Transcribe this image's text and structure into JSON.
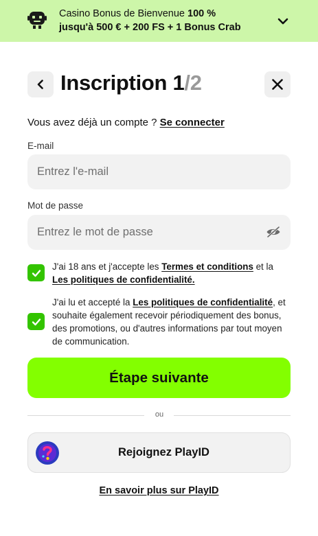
{
  "banner": {
    "icon": "robot-icon",
    "line1_normal": "Casino Bonus de Bienvenue ",
    "line1_bold": "100 %",
    "line2_bold": "jusqu'à 500 € + 200 FS + 1 Bonus Crab",
    "chevron": "chevron-down-icon",
    "bg_color": "#cdf6a9"
  },
  "header": {
    "back_icon": "chevron-left-icon",
    "title": "Inscription 1",
    "step_total": "/2",
    "close_icon": "close-icon"
  },
  "login_prompt": {
    "text": "Vous avez déjà un compte ? ",
    "link": "Se connecter"
  },
  "email": {
    "label": "E-mail",
    "placeholder": "Entrez l'e-mail",
    "value": ""
  },
  "password": {
    "label": "Mot de passe",
    "placeholder": "Entrez le mot de passe",
    "value": "",
    "toggle_icon": "eye-off-icon"
  },
  "consents": [
    {
      "checked": true,
      "text_1": "J'ai 18 ans et j'accepte les ",
      "link_1": "Termes et conditions",
      "text_2": " et la ",
      "link_2": "Les politiques de confidentialité."
    },
    {
      "checked": true,
      "text_1": "J'ai lu et accepté la ",
      "link_1": "Les politiques de confidentialité",
      "text_2": ", et souhaite également recevoir périodiquement des bonus, des promotions, ou d'autres informations par tout moyen de communication."
    }
  ],
  "next_button": {
    "label": "Étape suivante",
    "color": "#83ff00"
  },
  "divider_text": "ou",
  "playid": {
    "logo": "playid-logo-icon",
    "label": "Rejoignez PlayID"
  },
  "learn_more": "En savoir plus sur PlayID",
  "colors": {
    "checkbox": "#33c400",
    "input_bg": "#f2f2f2"
  }
}
